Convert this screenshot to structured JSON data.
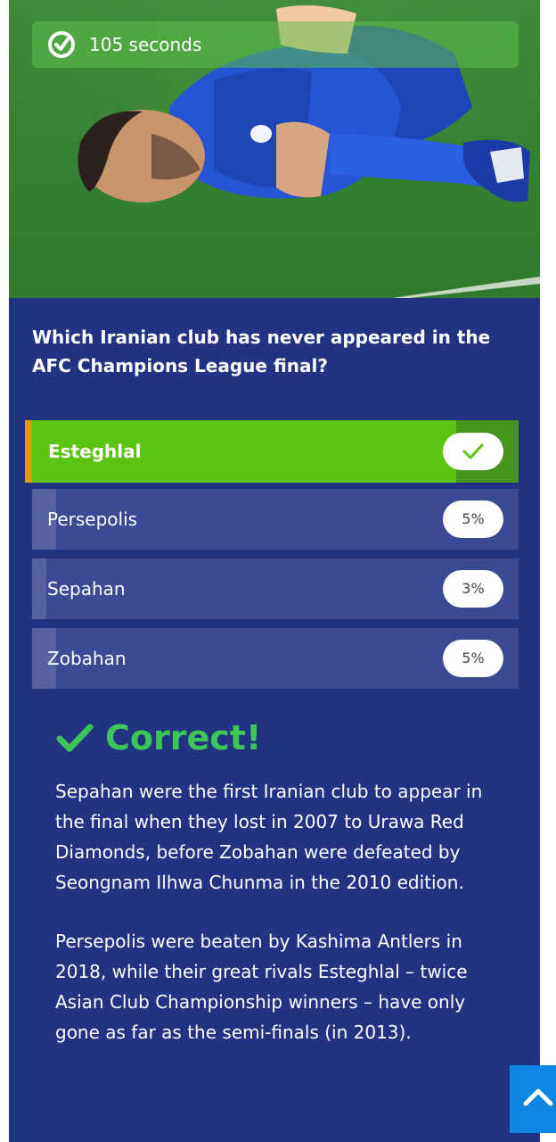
{
  "timer": {
    "icon": "timer-check-icon",
    "text": "105 seconds"
  },
  "hero": {
    "image": "footballer-injured-photo"
  },
  "question": {
    "text": "Which Iranian club has never appeared in the AFC Champions League final?"
  },
  "answers": [
    {
      "label": "Esteghlal",
      "correct": true,
      "indicator_icon": "check-icon"
    },
    {
      "label": "Persepolis",
      "percent": "5%",
      "share": 0.05
    },
    {
      "label": "Sepahan",
      "percent": "3%",
      "share": 0.03
    },
    {
      "label": "Zobahan",
      "percent": "5%",
      "share": 0.05
    }
  ],
  "result": {
    "icon": "check-icon",
    "title": "Correct!",
    "color": "#3bc656"
  },
  "explanation": {
    "paragraph1": "Sepahan were the first Iranian club to appear in the final when they lost in 2007 to Urawa Red Diamonds, before Zobahan were defeated by Seongnam Ilhwa Chunma in the 2010 edition.",
    "paragraph2": "Persepolis were beaten by Kashima Antlers in 2018, while their great rivals Esteghlal – twice Asian Club Championship winners – have only gone as far as the semi-finals (in 2013)."
  },
  "scroll_top": {
    "icon": "chevron-up-icon"
  },
  "colors": {
    "card_background": "#233384",
    "correct_green": "#5cc410",
    "accent_orange": "#e49b06",
    "scroll_button_blue": "#0d86e0"
  }
}
